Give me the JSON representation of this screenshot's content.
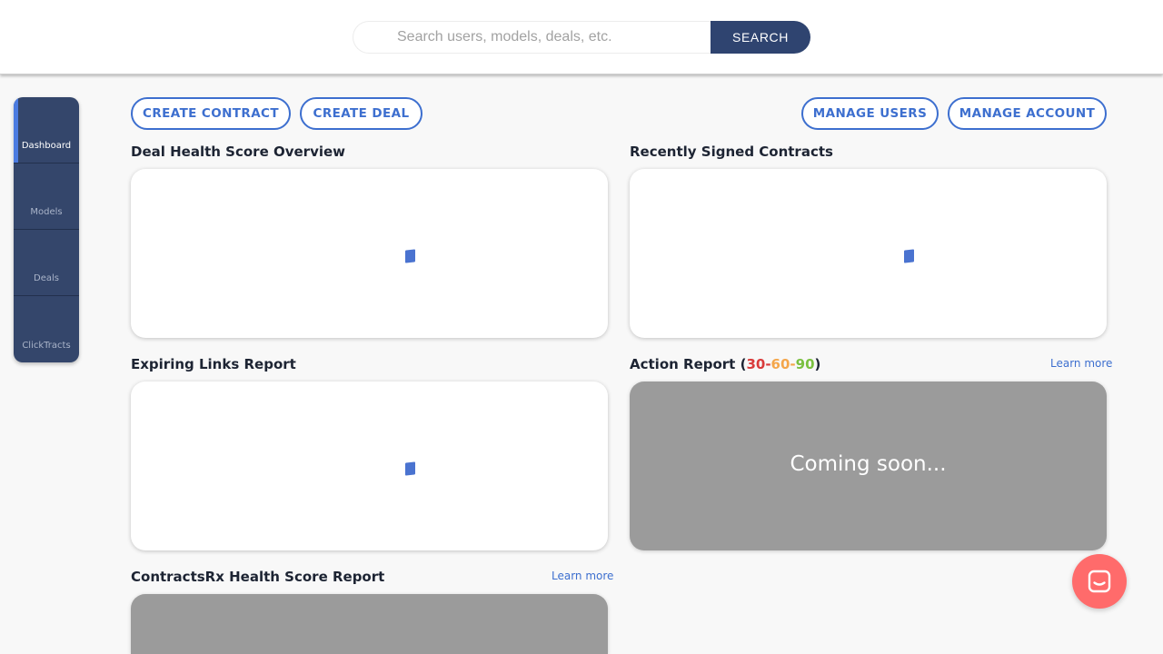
{
  "search": {
    "placeholder": "Search users, models, deals, etc.",
    "button_label": "SEARCH"
  },
  "sidebar": {
    "items": [
      {
        "label": "Dashboard",
        "active": true
      },
      {
        "label": "Models",
        "active": false
      },
      {
        "label": "Deals",
        "active": false
      },
      {
        "label": "ClickTracts",
        "active": false
      }
    ]
  },
  "actions": {
    "create_contract": "CREATE CONTRACT",
    "create_deal": "CREATE DEAL",
    "manage_users": "MANAGE USERS",
    "manage_account": "MANAGE ACCOUNT"
  },
  "sections": {
    "deal_health": {
      "title": "Deal Health Score Overview"
    },
    "recently_signed": {
      "title": "Recently Signed Contracts"
    },
    "expiring_links": {
      "title": "Expiring Links Report"
    },
    "action_report": {
      "title_prefix": "Action Report (",
      "n30": "30",
      "dash1": "-",
      "n60": "60",
      "dash2": "-",
      "n90": "90",
      "title_suffix": ")",
      "learn_more": "Learn more",
      "coming_soon": "Coming soon..."
    },
    "contractsrx": {
      "title": "ContractsRx Health Score Report",
      "learn_more": "Learn more"
    }
  },
  "colors": {
    "brand_navy": "#2f4470",
    "accent_blue": "#3d6fcf",
    "chat_coral": "#ff6b6b",
    "range_30": "#d93b3b",
    "range_60": "#f4a64b",
    "range_90": "#7ac040"
  },
  "icons": {
    "chat": "chat-bubble-icon",
    "loader": "loading-spinner-icon"
  }
}
